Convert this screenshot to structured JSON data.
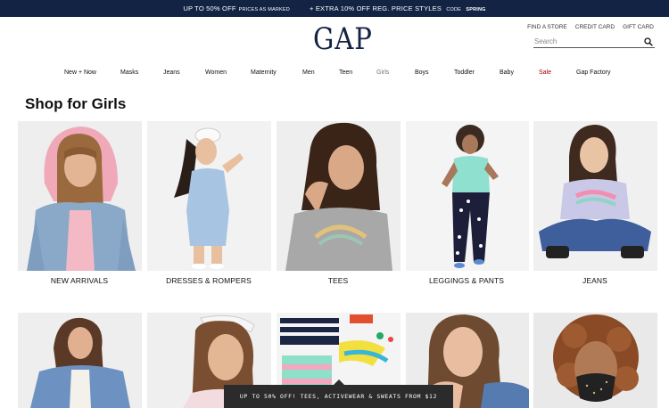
{
  "promo": {
    "offer1": "UP TO 50% OFF",
    "offer1_note": "PRICES AS MARKED",
    "offer2": "+ EXTRA 10% OFF REG. PRICE STYLES",
    "offer2_code_label": "CODE",
    "offer2_code": "SPRING"
  },
  "header": {
    "logo": "GAP",
    "util": [
      "FIND A STORE",
      "CREDIT CARD",
      "GIFT CARD"
    ],
    "search_placeholder": "Search"
  },
  "nav": [
    "New + Now",
    "Masks",
    "Jeans",
    "Women",
    "Maternity",
    "Men",
    "Teen",
    "Girls",
    "Boys",
    "Toddler",
    "Baby",
    "Sale",
    "Gap Factory"
  ],
  "page": {
    "title": "Shop for Girls"
  },
  "categories": [
    "NEW ARRIVALS",
    "DRESSES & ROMPERS",
    "TEES",
    "LEGGINGS & PANTS",
    "JEANS"
  ],
  "banner": "UP TO 50% OFF! TEES, ACTIVEWEAR & SWEATS FROM $12",
  "colors": {
    "navy": "#122344",
    "sale_red": "#a50010",
    "banner": "#2b2b2b"
  }
}
